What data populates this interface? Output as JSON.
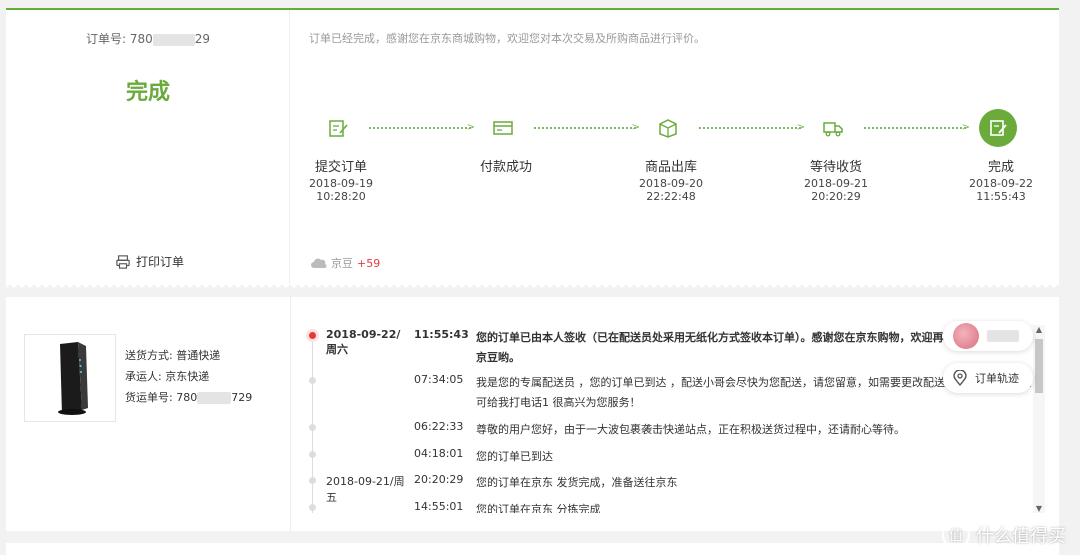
{
  "order": {
    "number_label": "订单号:",
    "number_prefix": "780",
    "number_suffix": "29",
    "status": "完成",
    "print_label": "打印订单",
    "thanks_text": "订单已经完成，感谢您在京东商城购物，欢迎您对本次交易及所购商品进行评价。",
    "accent_color": "#6aab3c"
  },
  "steps": [
    {
      "label": "提交订单",
      "date": "2018-09-19",
      "time": "10:28:20",
      "icon": "edit-order-icon"
    },
    {
      "label": "付款成功",
      "date": "",
      "time": "",
      "icon": "payment-card-icon"
    },
    {
      "label": "商品出库",
      "date": "2018-09-20",
      "time": "22:22:48",
      "icon": "package-out-icon"
    },
    {
      "label": "等待收货",
      "date": "2018-09-21",
      "time": "20:20:29",
      "icon": "truck-icon"
    },
    {
      "label": "完成",
      "date": "2018-09-22",
      "time": "11:55:43",
      "icon": "complete-icon"
    }
  ],
  "bean": {
    "label": "京豆",
    "value": "+59"
  },
  "shipping": {
    "method_label": "送货方式:",
    "method_value": "普通快递",
    "carrier_label": "承运人:",
    "carrier_value": "京东快递",
    "tracking_label": "货运单号:",
    "tracking_prefix": "780",
    "tracking_suffix": "729"
  },
  "tracking_rows": [
    {
      "date": "2018-09-22/周六",
      "time": "11:55:43",
      "msg": "您的订单已由本人签收（已在配送员处采用无纸化方式签收本订单）。感谢您在京东购物，欢迎再次光临。参加评价还能赢取京豆哟。"
    },
    {
      "date": "",
      "time": "07:34:05",
      "msg": "我是您的专属配送员 ，您的订单已到达 ，配送小哥会尽快为您配送，请您留意，如需要更改配送时间或者未如期到达，均可给我打电话1 很高兴为您服务！"
    },
    {
      "date": "",
      "time": "06:22:33",
      "msg": "尊敬的用户您好，由于一大波包裹袭击快递站点，正在积极送货过程中，还请耐心等待。"
    },
    {
      "date": "",
      "time": "04:18:01",
      "msg": "您的订单已到达"
    },
    {
      "date": "2018-09-21/周五",
      "time": "20:20:29",
      "msg": "您的订单在京东 发货完成，准备送往京东"
    },
    {
      "date": "",
      "time": "14:55:01",
      "msg": "您的订单在京东 分拣完成"
    }
  ],
  "side": {
    "track_button": "订单轨迹"
  },
  "watermark": {
    "text": "什么值得买",
    "logo": "值"
  }
}
